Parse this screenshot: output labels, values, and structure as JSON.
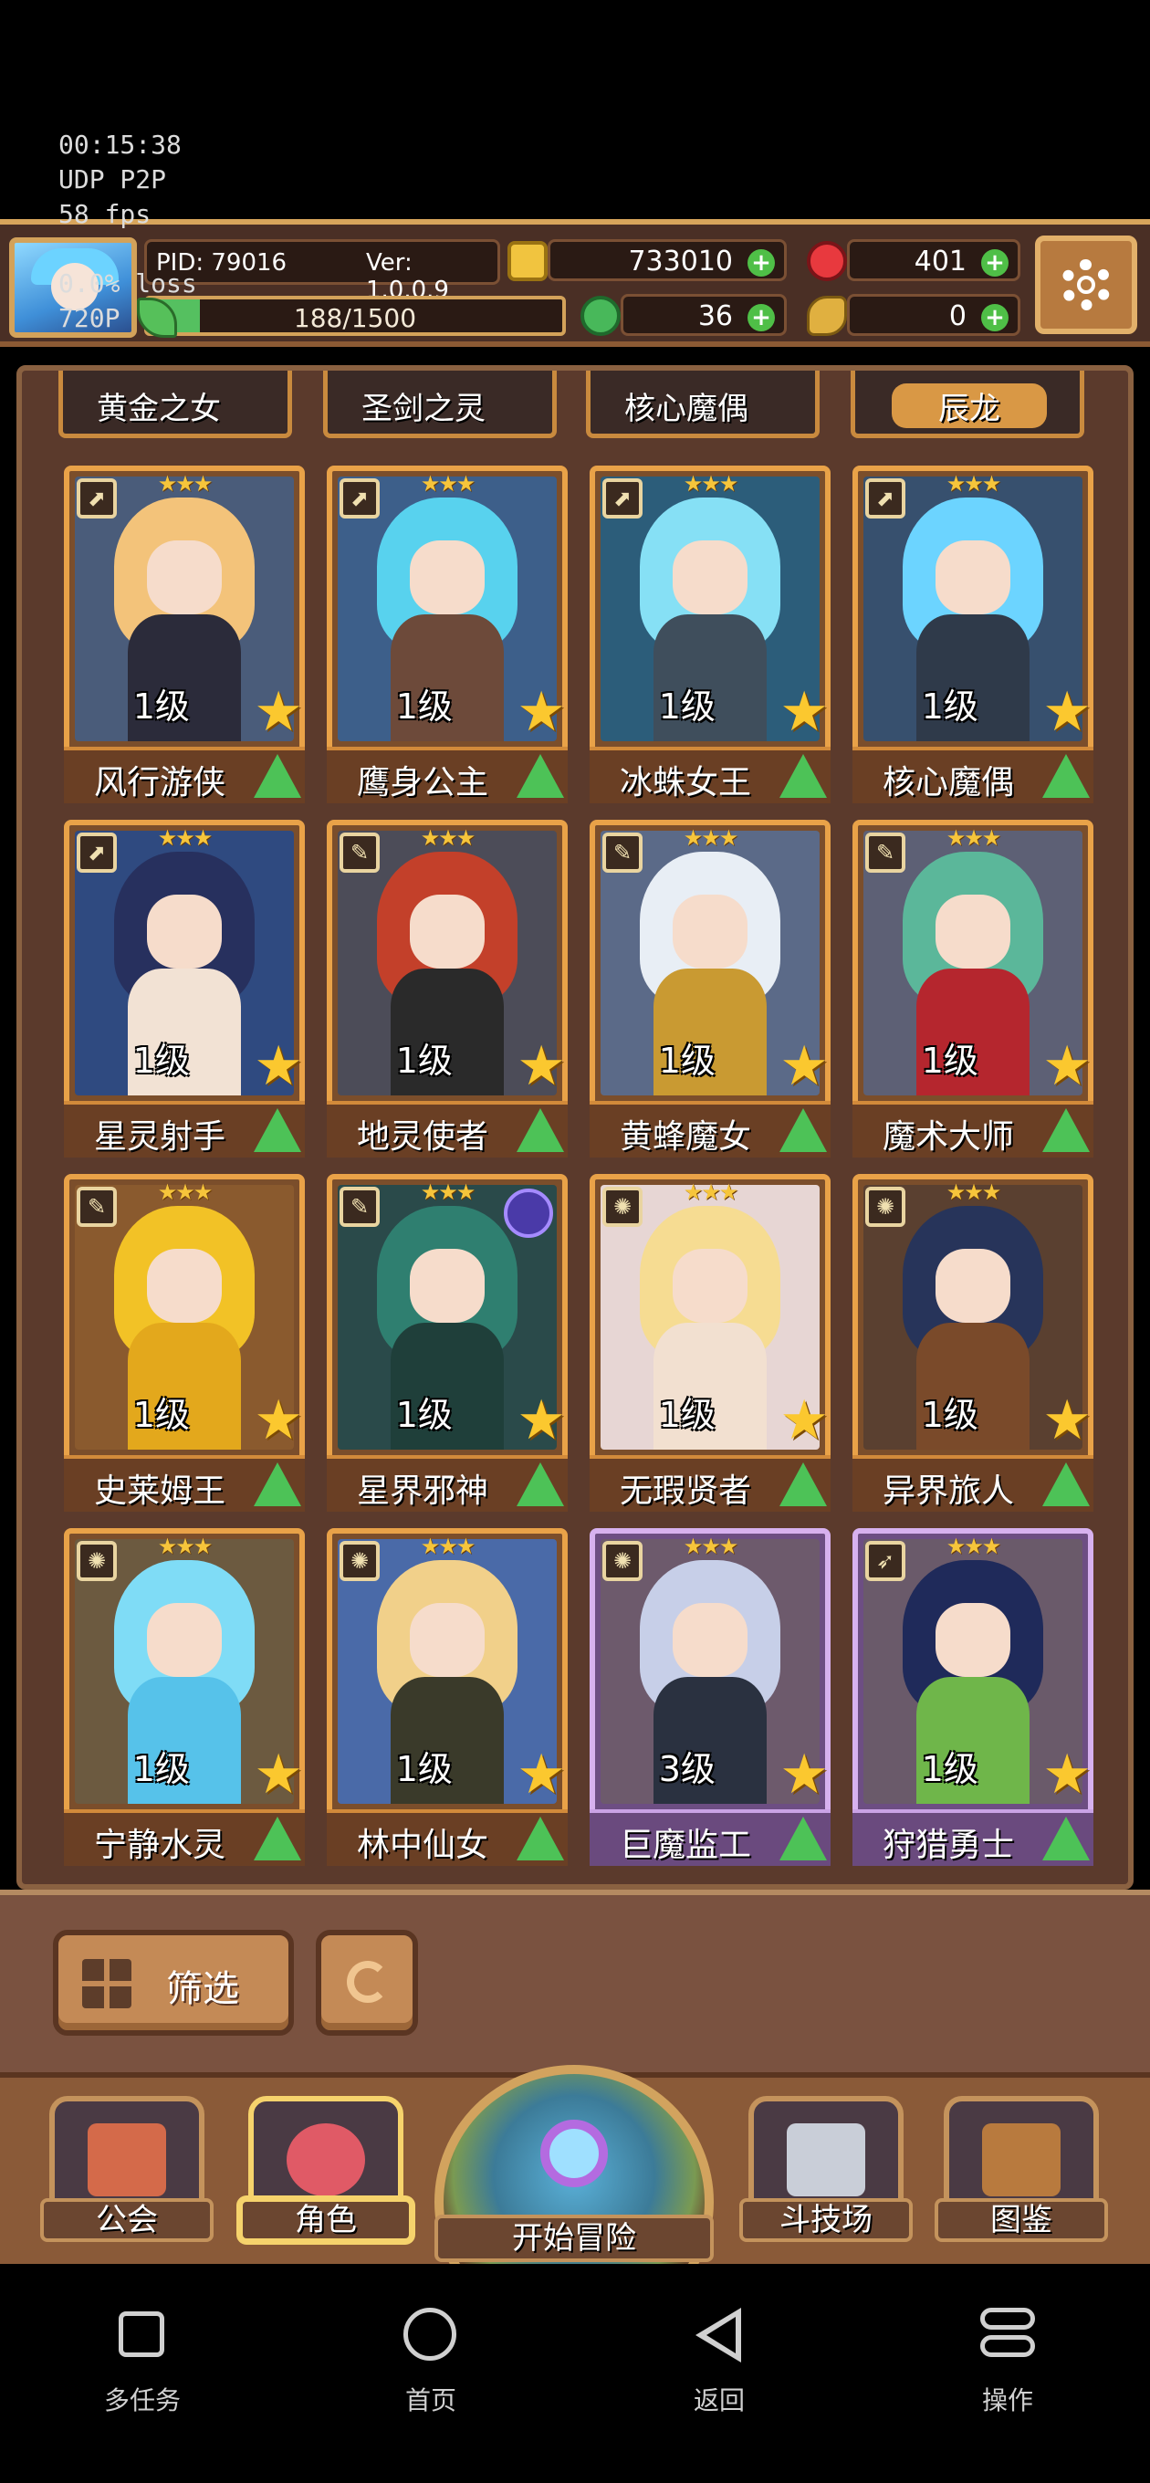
{
  "overlay": {
    "time": "00:15:38",
    "mode": "UDP P2P",
    "fps": "58 fps",
    "loss": "0.0% loss",
    "res": "720P"
  },
  "topbar": {
    "pid": "PID: 79016",
    "version": "Ver: 1.0.0.9",
    "exp_text": "188/1500",
    "exp_fraction": 0.125,
    "gold": "733010",
    "gems": "401",
    "clover": "36",
    "keys": "0",
    "plus": "+"
  },
  "partial_row": [
    {
      "name": "黄金之女"
    },
    {
      "name": "圣剑之灵"
    },
    {
      "name": "核心魔偶"
    },
    {
      "name": "辰龙"
    }
  ],
  "cards": [
    {
      "name": "风行游侠",
      "level": "1级",
      "stars": "★★★",
      "class": "⬈",
      "rarity": "normal",
      "hair": "#f3c37a",
      "body": "#2b2b3a",
      "bg": "#4a5c7a"
    },
    {
      "name": "鹰身公主",
      "level": "1级",
      "stars": "★★★",
      "class": "⬈",
      "rarity": "normal",
      "hair": "#58d2ee",
      "body": "#6d4a3a",
      "bg": "#3d5f8a"
    },
    {
      "name": "冰蛛女王",
      "level": "1级",
      "stars": "★★★",
      "class": "⬈",
      "rarity": "normal",
      "hair": "#86e0f5",
      "body": "#3f4e5c",
      "bg": "#2c5d7a"
    },
    {
      "name": "核心魔偶",
      "level": "1级",
      "stars": "★★★",
      "class": "⬈",
      "rarity": "normal",
      "hair": "#6cd4ff",
      "body": "#2f3a4a",
      "bg": "#37506e"
    },
    {
      "name": "星灵射手",
      "level": "1级",
      "stars": "★★★",
      "class": "⬈",
      "rarity": "normal",
      "hair": "#27305e",
      "body": "#f2e2d4",
      "bg": "#2f4a80"
    },
    {
      "name": "地灵使者",
      "level": "1级",
      "stars": "★★★",
      "class": "✎",
      "rarity": "normal",
      "hair": "#c3402a",
      "body": "#2a2a2a",
      "bg": "#4c4c58"
    },
    {
      "name": "黄蜂魔女",
      "level": "1级",
      "stars": "★★★",
      "class": "✎",
      "rarity": "normal",
      "hair": "#e8eef5",
      "body": "#c99a32",
      "bg": "#5b6a88"
    },
    {
      "name": "魔术大师",
      "level": "1级",
      "stars": "★★★",
      "class": "✎",
      "rarity": "normal",
      "hair": "#5bb79a",
      "body": "#b5262e",
      "bg": "#5d6075"
    },
    {
      "name": "史莱姆王",
      "level": "1级",
      "stars": "★★★",
      "class": "✎",
      "rarity": "normal",
      "hair": "#f2c226",
      "body": "#e3a81c",
      "bg": "#8a5a2e"
    },
    {
      "name": "星界邪神",
      "level": "1级",
      "stars": "★★★",
      "class": "✎",
      "rarity": "normal",
      "hair": "#2f7f70",
      "body": "#1f3f3a",
      "bg": "#2a4a4a"
    },
    {
      "name": "无瑕贤者",
      "level": "1级",
      "stars": "★★★",
      "class": "✺",
      "rarity": "normal",
      "hair": "#f6dc92",
      "body": "#f2e0d0",
      "bg": "#e7d6d4"
    },
    {
      "name": "异界旅人",
      "level": "1级",
      "stars": "★★★",
      "class": "✺",
      "rarity": "normal",
      "hair": "#27345a",
      "body": "#7a4a2a",
      "bg": "#5a4030"
    },
    {
      "name": "宁静水灵",
      "level": "1级",
      "stars": "★★★",
      "class": "✺",
      "rarity": "normal",
      "hair": "#7fdcf6",
      "body": "#56c2ea",
      "bg": "#6c5a40"
    },
    {
      "name": "林中仙女",
      "level": "1级",
      "stars": "★★★",
      "class": "✺",
      "rarity": "normal",
      "hair": "#f1d08a",
      "body": "#3a3a2a",
      "bg": "#4a6aa8"
    },
    {
      "name": "巨魔监工",
      "level": "3级",
      "stars": "★★★",
      "class": "✺",
      "rarity": "purple",
      "hair": "#c7cfe8",
      "body": "#2a3140",
      "bg": "#6d5a6c"
    },
    {
      "name": "狩猎勇士",
      "level": "1级",
      "stars": "★★★",
      "class": "➶",
      "rarity": "purple",
      "hair": "#1f2a5a",
      "body": "#6fb64a",
      "bg": "#6a5a6a"
    }
  ],
  "controls": {
    "filter_label": "筛选"
  },
  "bottom_nav": [
    {
      "label": "公会",
      "icon": "guild-icon",
      "color": "#d46a4a",
      "active": false
    },
    {
      "label": "角色",
      "icon": "character-icon",
      "color": "#e05a66",
      "active": true
    },
    {
      "label": "斗技场",
      "icon": "arena-icon",
      "color": "#c9ced8",
      "active": false
    },
    {
      "label": "图鉴",
      "icon": "codex-icon",
      "color": "#b87a3e",
      "active": false
    }
  ],
  "adventure_label": "开始冒险",
  "system_nav": [
    {
      "label": "多任务",
      "icon": "multitask-icon"
    },
    {
      "label": "首页",
      "icon": "home-icon"
    },
    {
      "label": "返回",
      "icon": "back-icon"
    },
    {
      "label": "操作",
      "icon": "operation-icon"
    }
  ]
}
